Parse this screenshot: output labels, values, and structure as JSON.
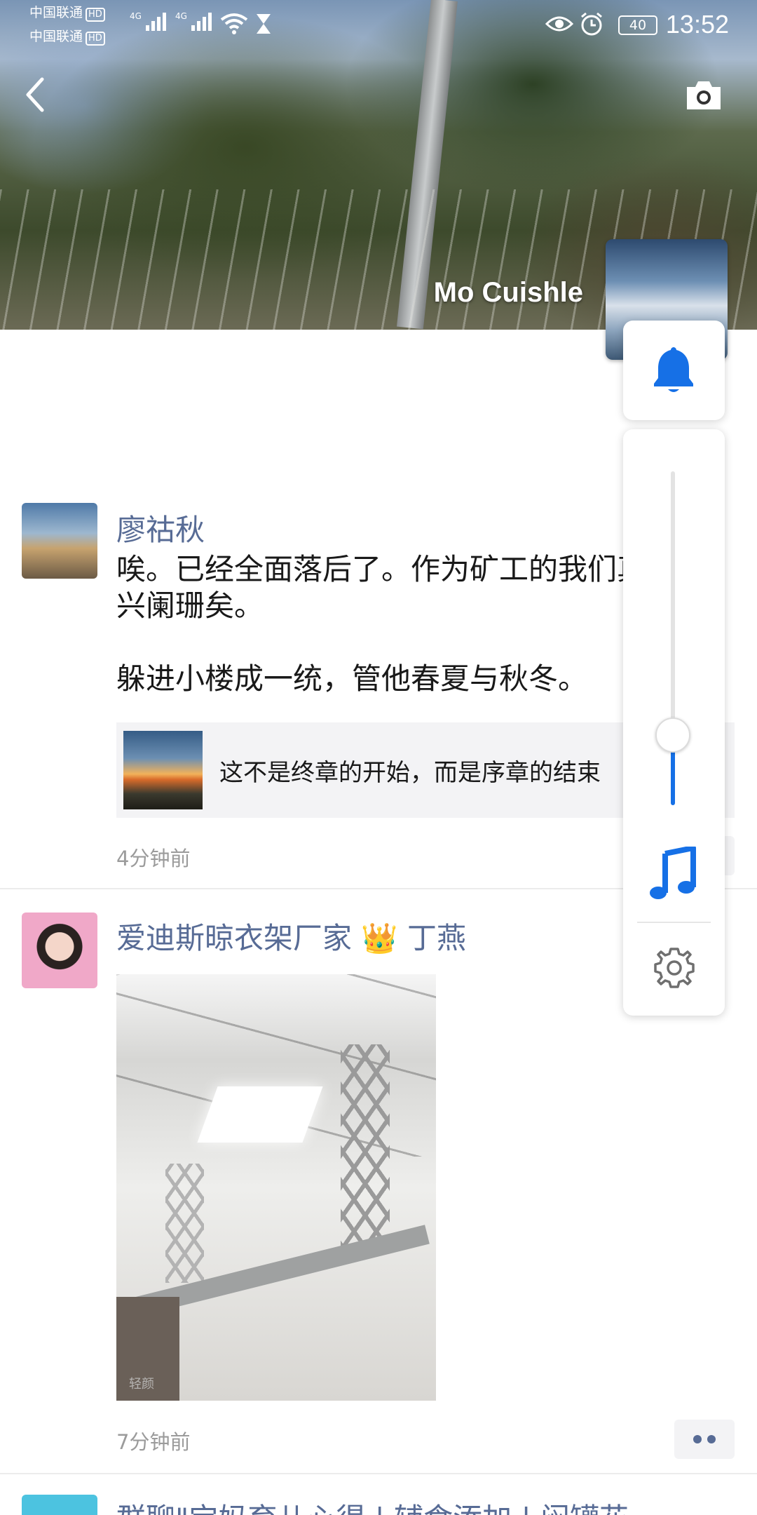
{
  "status_bar": {
    "carrier_1": "中国联通",
    "carrier_2": "中国联通",
    "hd_label": "HD",
    "network_1": "4G",
    "network_2": "4G",
    "battery": "40",
    "time": "13:52"
  },
  "cover": {
    "user_name": "Mo Cuishle"
  },
  "posts": [
    {
      "author": "廖祜秋",
      "content": "唉。已经全面落后了。作为矿工的我们真\n兴阑珊矣。\n\n躲进小楼成一统，管他春夏与秋冬。",
      "share_title": "这不是终章的开始，而是序章的结束",
      "timestamp": "4分钟前"
    },
    {
      "author": "爱迪斯晾衣架厂家 👑 丁燕",
      "photo_watermark": "轻颜",
      "timestamp": "7分钟前"
    },
    {
      "author": "群聊\"宝妈育儿心得 | 辅食添加 | 闷罐花"
    }
  ],
  "volume_panel": {
    "level_percent": 21,
    "accent": "#1670e6"
  },
  "icons": [
    "back-icon",
    "camera-icon",
    "bell-icon",
    "music-note-icon",
    "gear-icon",
    "more-dots-icon"
  ]
}
